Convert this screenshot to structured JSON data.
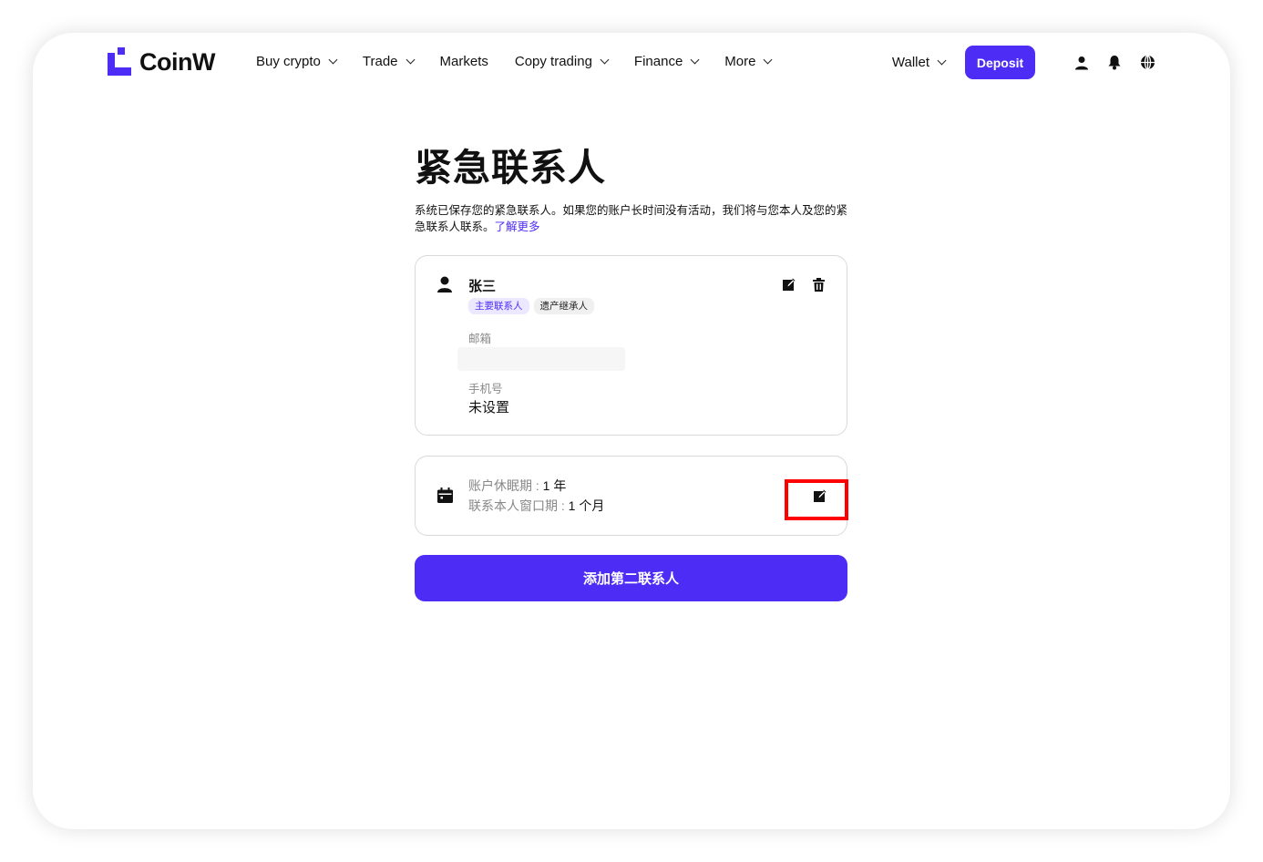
{
  "brand": {
    "name": "CoinW",
    "accent_color": "#4d2cf6",
    "alert_color": "#ff0000"
  },
  "nav": {
    "items": [
      {
        "label": "Buy crypto",
        "has_dropdown": true
      },
      {
        "label": "Trade",
        "has_dropdown": true
      },
      {
        "label": "Markets",
        "has_dropdown": false
      },
      {
        "label": "Copy trading",
        "has_dropdown": true
      },
      {
        "label": "Finance",
        "has_dropdown": true
      },
      {
        "label": "More",
        "has_dropdown": true
      }
    ],
    "wallet_label": "Wallet",
    "deposit_label": "Deposit",
    "icons": [
      "user-icon",
      "bell-icon",
      "globe-icon"
    ]
  },
  "page": {
    "title": "紧急联系人",
    "description": "系统已保存您的紧急联系人。如果您的账户长时间没有活动，我们将与您本人及您的紧急联系人联系。",
    "learn_more": "了解更多"
  },
  "contact": {
    "name": "张三",
    "tags": [
      "主要联系人",
      "遗产继承人"
    ],
    "email_label": "邮箱",
    "email_value": "",
    "phone_label": "手机号",
    "phone_value": "未设置"
  },
  "periods": {
    "dormancy_label": "账户休眠期 : ",
    "dormancy_value": "1 年",
    "window_label": "联系本人窗口期 : ",
    "window_value": "1 个月"
  },
  "add_button": "添加第二联系人"
}
